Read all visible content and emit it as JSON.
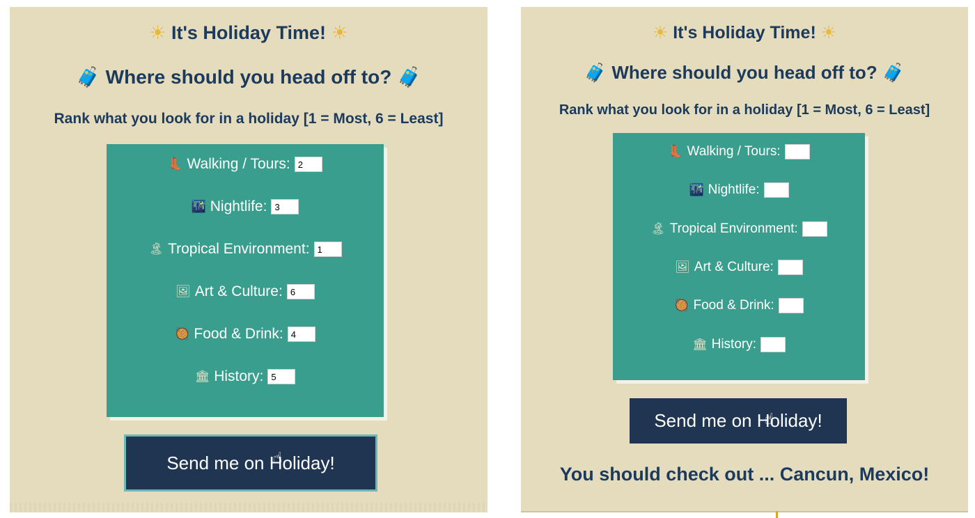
{
  "left": {
    "title": "It's Holiday Time!",
    "subtitle": "Where should you head off to?",
    "instruction": "Rank what you look for in a holiday [1 = Most, 6 = Least]",
    "rows": [
      {
        "icon": "hiking-boot-icon",
        "glyph": "👢",
        "label": "Walking / Tours:",
        "value": "2"
      },
      {
        "icon": "city-night-icon",
        "glyph": "🌃",
        "label": "Nightlife:",
        "value": "3"
      },
      {
        "icon": "desert-island-icon",
        "glyph": "🏝",
        "label": "Tropical Environment:",
        "value": "1"
      },
      {
        "icon": "framed-picture-icon",
        "glyph": "🖼",
        "label": "Art & Culture:",
        "value": "6"
      },
      {
        "icon": "food-icon",
        "glyph": "🥘",
        "label": "Food & Drink:",
        "value": "4"
      },
      {
        "icon": "classical-building-icon",
        "glyph": "🏛",
        "label": "History:",
        "value": "5"
      }
    ],
    "button": "Send me on Holiday!"
  },
  "right": {
    "title": "It's Holiday Time!",
    "subtitle": "Where should you head off to?",
    "instruction": "Rank what you look for in a holiday [1 = Most, 6 = Least]",
    "rows": [
      {
        "icon": "hiking-boot-icon",
        "glyph": "👢",
        "label": "Walking / Tours:",
        "value": ""
      },
      {
        "icon": "city-night-icon",
        "glyph": "🌃",
        "label": "Nightlife:",
        "value": ""
      },
      {
        "icon": "desert-island-icon",
        "glyph": "🏝",
        "label": "Tropical Environment:",
        "value": ""
      },
      {
        "icon": "framed-picture-icon",
        "glyph": "🖼",
        "label": "Art & Culture:",
        "value": ""
      },
      {
        "icon": "food-icon",
        "glyph": "🥘",
        "label": "Food & Drink:",
        "value": ""
      },
      {
        "icon": "classical-building-icon",
        "glyph": "🏛",
        "label": "History:",
        "value": ""
      }
    ],
    "button": "Send me on Holiday!",
    "result": "You should check out ... Cancun, Mexico!"
  },
  "icons": {
    "sun": "☀",
    "luggage": "🧳",
    "cursor": "☝"
  },
  "colors": {
    "background": "#e5dcbd",
    "heading": "#1b3a5c",
    "form_box": "#3a9e8e",
    "button": "#1f3551"
  }
}
